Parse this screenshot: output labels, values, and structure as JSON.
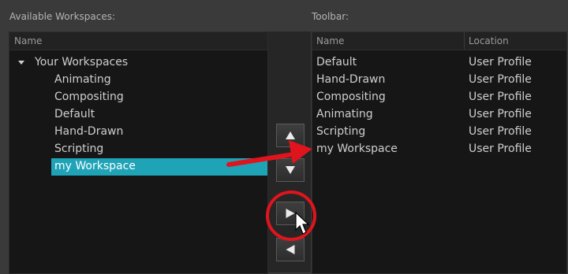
{
  "available": {
    "section_label": "Available Workspaces:",
    "column_header": "Name",
    "root_label": "Your Workspaces",
    "items": [
      "Animating",
      "Compositing",
      "Default",
      "Hand-Drawn",
      "Scripting",
      "my Workspace"
    ],
    "selected_item": "my Workspace"
  },
  "toolbar": {
    "section_label": "Toolbar:",
    "columns": [
      "Name",
      "Location"
    ],
    "rows": [
      {
        "name": "Default",
        "location": "User Profile"
      },
      {
        "name": "Hand-Drawn",
        "location": "User Profile"
      },
      {
        "name": "Compositing",
        "location": "User Profile"
      },
      {
        "name": "Animating",
        "location": "User Profile"
      },
      {
        "name": "Scripting",
        "location": "User Profile"
      },
      {
        "name": "my Workspace",
        "location": "User Profile"
      }
    ]
  },
  "buttons": {
    "move_up_icon": "triangle-up-icon",
    "move_down_icon": "triangle-down-icon",
    "add_icon": "triangle-right-icon",
    "remove_icon": "triangle-left-icon"
  },
  "annotations": {
    "arrow_color": "#e0141c",
    "circle_color": "#e0141c"
  },
  "colors": {
    "selection": "#1fa3b7",
    "pane_bg": "#161616",
    "window_bg": "#3a3a3a"
  }
}
